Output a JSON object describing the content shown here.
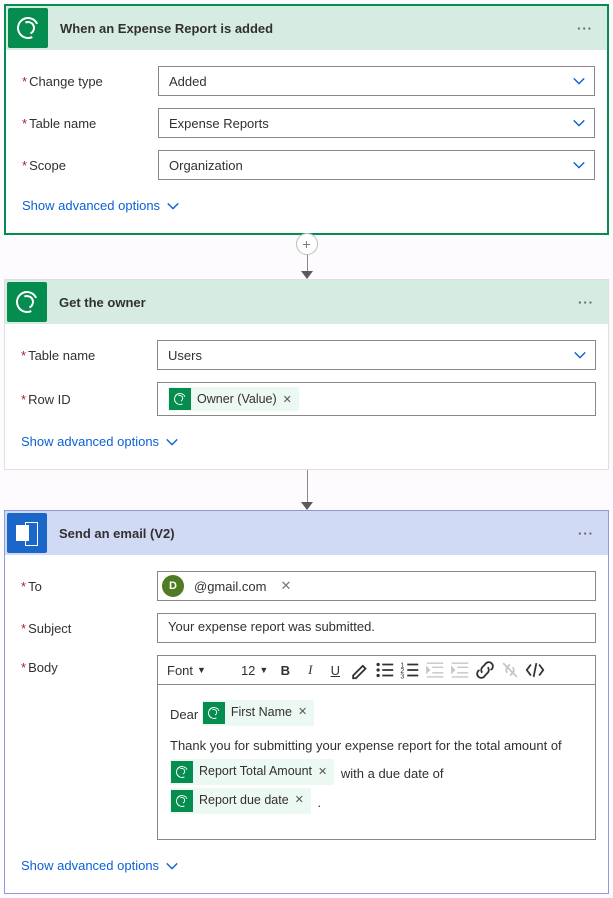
{
  "trigger": {
    "title": "When an Expense Report is added",
    "rows": {
      "change_type": {
        "label": "Change type",
        "value": "Added"
      },
      "table_name": {
        "label": "Table name",
        "value": "Expense Reports"
      },
      "scope": {
        "label": "Scope",
        "value": "Organization"
      }
    },
    "advanced": "Show advanced options"
  },
  "get_owner": {
    "title": "Get the owner",
    "rows": {
      "table_name": {
        "label": "Table name",
        "value": "Users"
      },
      "row_id": {
        "label": "Row ID"
      }
    },
    "token": "Owner (Value)",
    "advanced": "Show advanced options"
  },
  "email": {
    "title": "Send an email (V2)",
    "rows": {
      "to": {
        "label": "To"
      },
      "subject": {
        "label": "Subject",
        "value": "Your expense report was submitted."
      },
      "body": {
        "label": "Body"
      }
    },
    "to_chip": {
      "avatar_letter": "D",
      "address": "@gmail.com"
    },
    "toolbar": {
      "font": "Font",
      "size": "12"
    },
    "body_text": {
      "greeting": "Dear",
      "line2a": "Thank you for submitting your expense report for the total amount of",
      "line2b": "with a due date of",
      "period": "."
    },
    "tokens": {
      "first_name": "First Name",
      "total": "Report Total Amount",
      "due": "Report due date"
    },
    "advanced": "Show advanced options"
  }
}
